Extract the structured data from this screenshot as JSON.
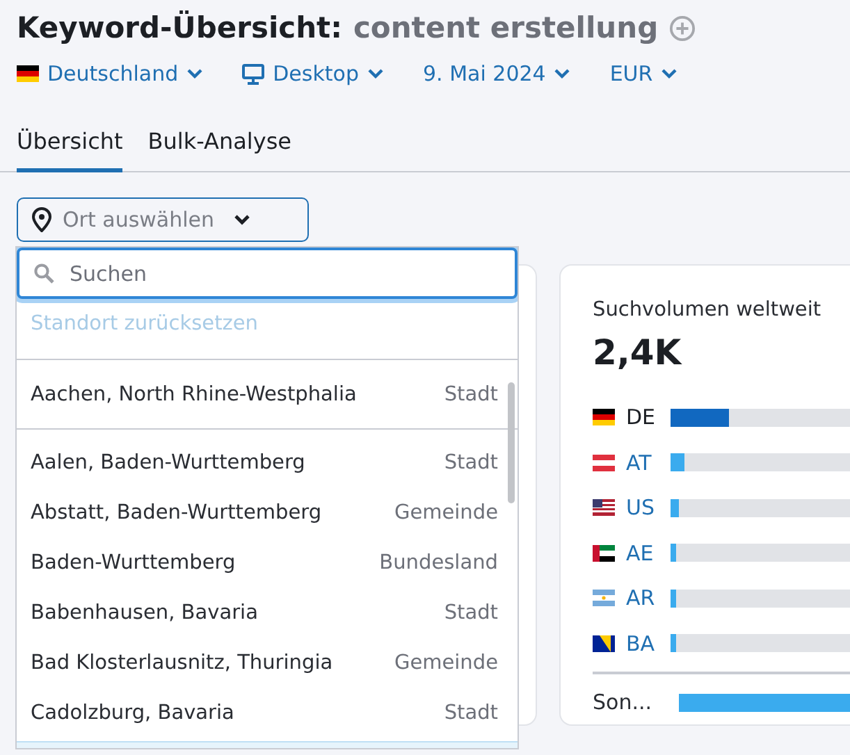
{
  "header": {
    "title": "Keyword-Übersicht:",
    "keyword": "content erstellung"
  },
  "filters": [
    {
      "kind": "country",
      "label": "Deutschland"
    },
    {
      "kind": "device",
      "label": "Desktop"
    },
    {
      "kind": "plain",
      "label": "9. Mai 2024"
    },
    {
      "kind": "plain",
      "label": "EUR"
    }
  ],
  "tabs": [
    {
      "label": "Übersicht",
      "selected": true
    },
    {
      "label": "Bulk-Analyse",
      "selected": false
    }
  ],
  "location_picker": {
    "label": "Ort auswählen",
    "search": {
      "placeholder": "Suchen"
    },
    "reset": "Standort zurücksetzen",
    "items": [
      {
        "name": "Aachen, North Rhine-Westphalia",
        "type": "Stadt"
      },
      {
        "name": "Aalen, Baden-Wurttemberg",
        "type": "Stadt"
      },
      {
        "name": "Abstatt, Baden-Wurttemberg",
        "type": "Gemeinde"
      },
      {
        "name": "Baden-Wurttemberg",
        "type": "Bundesland"
      },
      {
        "name": "Babenhausen, Bavaria",
        "type": "Stadt"
      },
      {
        "name": "Bad Klosterlausnitz, Thuringia",
        "type": "Gemeinde"
      },
      {
        "name": "Cadolzburg, Bavaria",
        "type": "Stadt"
      }
    ]
  },
  "volume_card": {
    "title": "Suchvolumen weltweit",
    "value": "2,4K",
    "countries": [
      {
        "code": "DE",
        "selected": true,
        "level": 0.3
      },
      {
        "code": "AT",
        "selected": false,
        "level": 0.07
      },
      {
        "code": "US",
        "selected": false,
        "level": 0.04
      },
      {
        "code": "AE",
        "selected": false,
        "level": 0.03
      },
      {
        "code": "AR",
        "selected": false,
        "level": 0.03
      },
      {
        "code": "BA",
        "selected": false,
        "level": 0.03
      }
    ],
    "other": {
      "label": "Son...",
      "level": 1
    }
  }
}
